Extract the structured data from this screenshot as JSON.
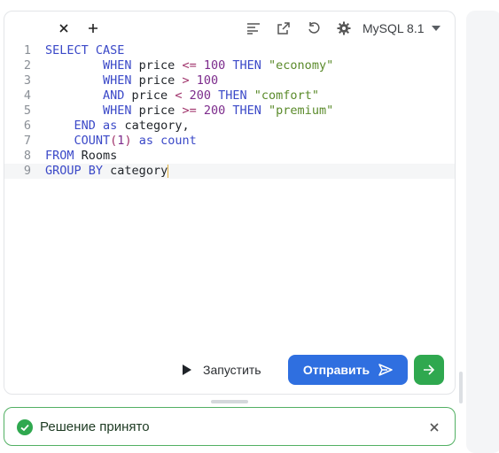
{
  "toolbar": {
    "close_tab_icon": "close-icon",
    "add_tab_icon": "plus-icon",
    "tools": [
      "format-icon",
      "external-link-icon",
      "reset-icon",
      "settings-icon"
    ],
    "language": "MySQL 8.1"
  },
  "editor": {
    "line_numbers": [
      "1",
      "2",
      "3",
      "4",
      "5",
      "6",
      "7",
      "8",
      "9"
    ]
  },
  "actions": {
    "run_label": "Запустить",
    "submit_label": "Отправить",
    "submit_color": "#2f6fe0",
    "next_color": "#2fa84f"
  },
  "status": {
    "text": "Решение принято",
    "color": "#2fa84f"
  }
}
